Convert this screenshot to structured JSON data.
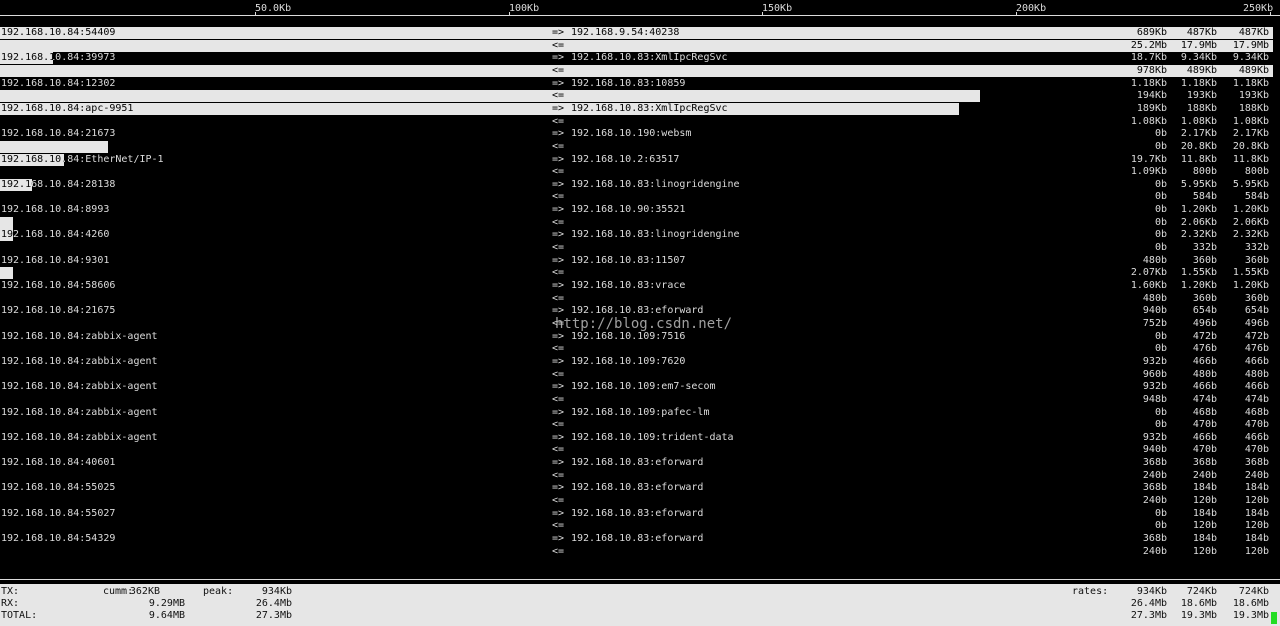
{
  "scale": [
    "50.0Kb",
    "100Kb",
    "150Kb",
    "200Kb",
    "250Kb"
  ],
  "rows": [
    {
      "src": "192.168.10.84:54409",
      "dst": "192.168.9.54:40238",
      "tx": [
        "689Kb",
        "487Kb",
        "487Kb"
      ],
      "rx": [
        "25.2Mb",
        "17.9Mb",
        "17.9Mb"
      ]
    },
    {
      "src": "192.168.10.84:39973",
      "dst": "192.168.10.83:XmlIpcRegSvc",
      "tx": [
        "18.7Kb",
        "9.34Kb",
        "9.34Kb"
      ],
      "rx": [
        "978Kb",
        "489Kb",
        "489Kb"
      ]
    },
    {
      "src": "192.168.10.84:12302",
      "dst": "192.168.10.83:10859",
      "tx": [
        "1.18Kb",
        "1.18Kb",
        "1.18Kb"
      ],
      "rx": [
        "194Kb",
        "193Kb",
        "193Kb"
      ]
    },
    {
      "src": "192.168.10.84:apc-9951",
      "dst": "192.168.10.83:XmlIpcRegSvc",
      "tx": [
        "189Kb",
        "188Kb",
        "188Kb"
      ],
      "rx": [
        "1.08Kb",
        "1.08Kb",
        "1.08Kb"
      ]
    },
    {
      "src": "192.168.10.84:21673",
      "dst": "192.168.10.190:websm",
      "tx": [
        "0b",
        "2.17Kb",
        "2.17Kb"
      ],
      "rx": [
        "0b",
        "20.8Kb",
        "20.8Kb"
      ]
    },
    {
      "src": "192.168.10.84:EtherNet/IP-1",
      "dst": "192.168.10.2:63517",
      "tx": [
        "19.7Kb",
        "11.8Kb",
        "11.8Kb"
      ],
      "rx": [
        "1.09Kb",
        "800b",
        "800b"
      ]
    },
    {
      "src": "192.168.10.84:28138",
      "dst": "192.168.10.83:linogridengine",
      "tx": [
        "0b",
        "5.95Kb",
        "5.95Kb"
      ],
      "rx": [
        "0b",
        "584b",
        "584b"
      ]
    },
    {
      "src": "192.168.10.84:8993",
      "dst": "192.168.10.90:35521",
      "tx": [
        "0b",
        "1.20Kb",
        "1.20Kb"
      ],
      "rx": [
        "0b",
        "2.06Kb",
        "2.06Kb"
      ]
    },
    {
      "src": "192.168.10.84:4260",
      "dst": "192.168.10.83:linogridengine",
      "tx": [
        "0b",
        "2.32Kb",
        "2.32Kb"
      ],
      "rx": [
        "0b",
        "332b",
        "332b"
      ]
    },
    {
      "src": "192.168.10.84:9301",
      "dst": "192.168.10.83:11507",
      "tx": [
        "480b",
        "360b",
        "360b"
      ],
      "rx": [
        "2.07Kb",
        "1.55Kb",
        "1.55Kb"
      ]
    },
    {
      "src": "192.168.10.84:58606",
      "dst": "192.168.10.83:vrace",
      "tx": [
        "1.60Kb",
        "1.20Kb",
        "1.20Kb"
      ],
      "rx": [
        "480b",
        "360b",
        "360b"
      ]
    },
    {
      "src": "192.168.10.84:21675",
      "dst": "192.168.10.83:eforward",
      "tx": [
        "940b",
        "654b",
        "654b"
      ],
      "rx": [
        "752b",
        "496b",
        "496b"
      ]
    },
    {
      "src": "192.168.10.84:zabbix-agent",
      "dst": "192.168.10.109:7516",
      "tx": [
        "0b",
        "472b",
        "472b"
      ],
      "rx": [
        "0b",
        "476b",
        "476b"
      ]
    },
    {
      "src": "192.168.10.84:zabbix-agent",
      "dst": "192.168.10.109:7620",
      "tx": [
        "932b",
        "466b",
        "466b"
      ],
      "rx": [
        "960b",
        "480b",
        "480b"
      ]
    },
    {
      "src": "192.168.10.84:zabbix-agent",
      "dst": "192.168.10.109:em7-secom",
      "tx": [
        "932b",
        "466b",
        "466b"
      ],
      "rx": [
        "948b",
        "474b",
        "474b"
      ]
    },
    {
      "src": "192.168.10.84:zabbix-agent",
      "dst": "192.168.10.109:pafec-lm",
      "tx": [
        "0b",
        "468b",
        "468b"
      ],
      "rx": [
        "0b",
        "470b",
        "470b"
      ]
    },
    {
      "src": "192.168.10.84:zabbix-agent",
      "dst": "192.168.10.109:trident-data",
      "tx": [
        "932b",
        "466b",
        "466b"
      ],
      "rx": [
        "940b",
        "470b",
        "470b"
      ]
    },
    {
      "src": "192.168.10.84:40601",
      "dst": "192.168.10.83:eforward",
      "tx": [
        "368b",
        "368b",
        "368b"
      ],
      "rx": [
        "240b",
        "240b",
        "240b"
      ]
    },
    {
      "src": "192.168.10.84:55025",
      "dst": "192.168.10.83:eforward",
      "tx": [
        "368b",
        "184b",
        "184b"
      ],
      "rx": [
        "240b",
        "120b",
        "120b"
      ]
    },
    {
      "src": "192.168.10.84:55027",
      "dst": "192.168.10.83:eforward",
      "tx": [
        "0b",
        "184b",
        "184b"
      ],
      "rx": [
        "0b",
        "120b",
        "120b"
      ]
    },
    {
      "src": "192.168.10.84:54329",
      "dst": "192.168.10.83:eforward",
      "tx": [
        "368b",
        "184b",
        "184b"
      ],
      "rx": [
        "240b",
        "120b",
        "120b"
      ]
    }
  ],
  "arrows": {
    "tx": "=>",
    "rx": "<="
  },
  "watermark": "http://blog.csdn.net/",
  "footer": {
    "tx": {
      "label": "TX:",
      "cumm_label": "cumm:",
      "cumm": "362KB",
      "peak_label": "peak:",
      "peak": "934Kb",
      "rates_label": "rates:",
      "rates": [
        "934Kb",
        "724Kb",
        "724Kb"
      ]
    },
    "rx": {
      "label": "RX:",
      "cumm": "9.29MB",
      "peak": "26.4Mb",
      "rates": [
        "26.4Mb",
        "18.6Mb",
        "18.6Mb"
      ]
    },
    "total": {
      "label": "TOTAL:",
      "cumm": "9.64MB",
      "peak": "27.3Mb",
      "rates": [
        "27.3Mb",
        "19.3Mb",
        "19.3Mb"
      ]
    }
  },
  "bar_fractions": [
    {
      "tx": 1.0,
      "rx": 1.0
    },
    {
      "tx": 0.042,
      "rx": 1.0
    },
    {
      "tx": 0.0,
      "rx": 0.77
    },
    {
      "tx": 0.753,
      "rx": 0.0
    },
    {
      "tx": 0.0,
      "rx": 0.085
    },
    {
      "tx": 0.05,
      "rx": 0.0
    },
    {
      "tx": 0.025,
      "rx": 0.0
    },
    {
      "tx": 0.0,
      "rx": 0.01
    },
    {
      "tx": 0.01,
      "rx": 0.0
    },
    {
      "tx": 0.0,
      "rx": 0.01
    },
    {
      "tx": 0.0,
      "rx": 0.0
    }
  ]
}
